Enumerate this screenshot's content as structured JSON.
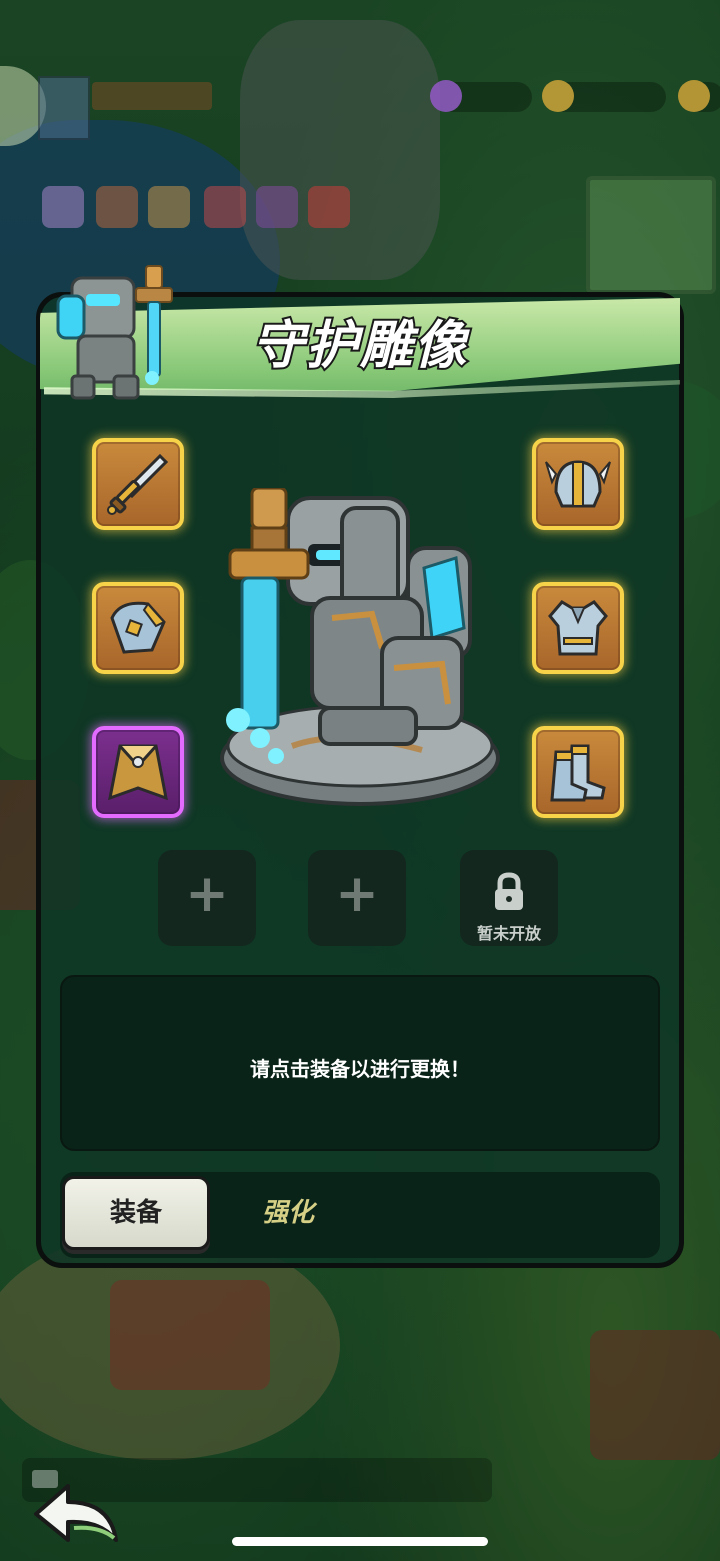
{
  "panel": {
    "title": "守护雕像",
    "hint": "请点击装备以进行更换！",
    "tabs": {
      "equip": "装备",
      "upgrade": "强化"
    }
  },
  "equipment": {
    "left": [
      {
        "slot": "weapon",
        "icon": "sword-icon",
        "rarity": "legendary"
      },
      {
        "slot": "shoulder",
        "icon": "shoulder-guard-icon",
        "rarity": "legendary"
      },
      {
        "slot": "cape",
        "icon": "cape-icon",
        "rarity": "epic"
      }
    ],
    "right": [
      {
        "slot": "helmet",
        "icon": "helmet-icon",
        "rarity": "legendary"
      },
      {
        "slot": "armor",
        "icon": "armor-icon",
        "rarity": "legendary"
      },
      {
        "slot": "boots",
        "icon": "boots-icon",
        "rarity": "legendary"
      }
    ]
  },
  "sockets": [
    {
      "state": "empty",
      "label": "+"
    },
    {
      "state": "empty",
      "label": "+"
    },
    {
      "state": "locked",
      "label": "暂未开放"
    }
  ],
  "colors": {
    "legendary_border": "#f7d34a",
    "epic_border": "#e36bff",
    "title_band": "#86c776",
    "panel_bg": "#0e3525"
  }
}
